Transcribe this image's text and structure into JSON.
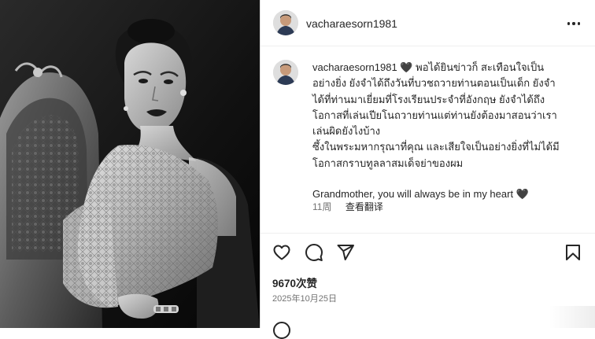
{
  "post": {
    "username": "vacharaesorn1981",
    "caption_lines": [
      "พอได้ยินข่าวก็ สะเทือนใจเป็น",
      "อย่างยิ่ง ยังจำได้ถึงวันที่บวชถวายท่านตอนเป็นเด็ก ยังจำ",
      "ได้ที่ท่านมาเยี่ยมที่โรงเรียนประจำที่อังกฤษ ยังจำได้ถึง",
      "โอกาสที่เล่นเปียโนถวายท่านแต่ท่านยังต้องมาสอนว่าเรา",
      "เล่นผิดยังไงบ้าง",
      "ซึ้งในพระมหากรุณาที่คุณ และเสียใจเป็นอย่างยิ่งที่ไม่ได้มี",
      "โอกาสกราบทูลลาสมเด็จย่าของผม"
    ],
    "caption_english": "Grandmother, you will always be in my heart 🖤",
    "caption_emoji": "🖤",
    "time_ago": "11周",
    "translate_label": "查看翻译",
    "likes": "9670次赞",
    "date": "2025年10月25日"
  },
  "icons": {
    "more": "more-options-icon",
    "like": "heart-icon",
    "comment": "comment-icon",
    "share": "share-icon",
    "save": "bookmark-icon"
  },
  "colors": {
    "text": "#262626",
    "secondary": "#737373",
    "divider": "#efefef"
  }
}
